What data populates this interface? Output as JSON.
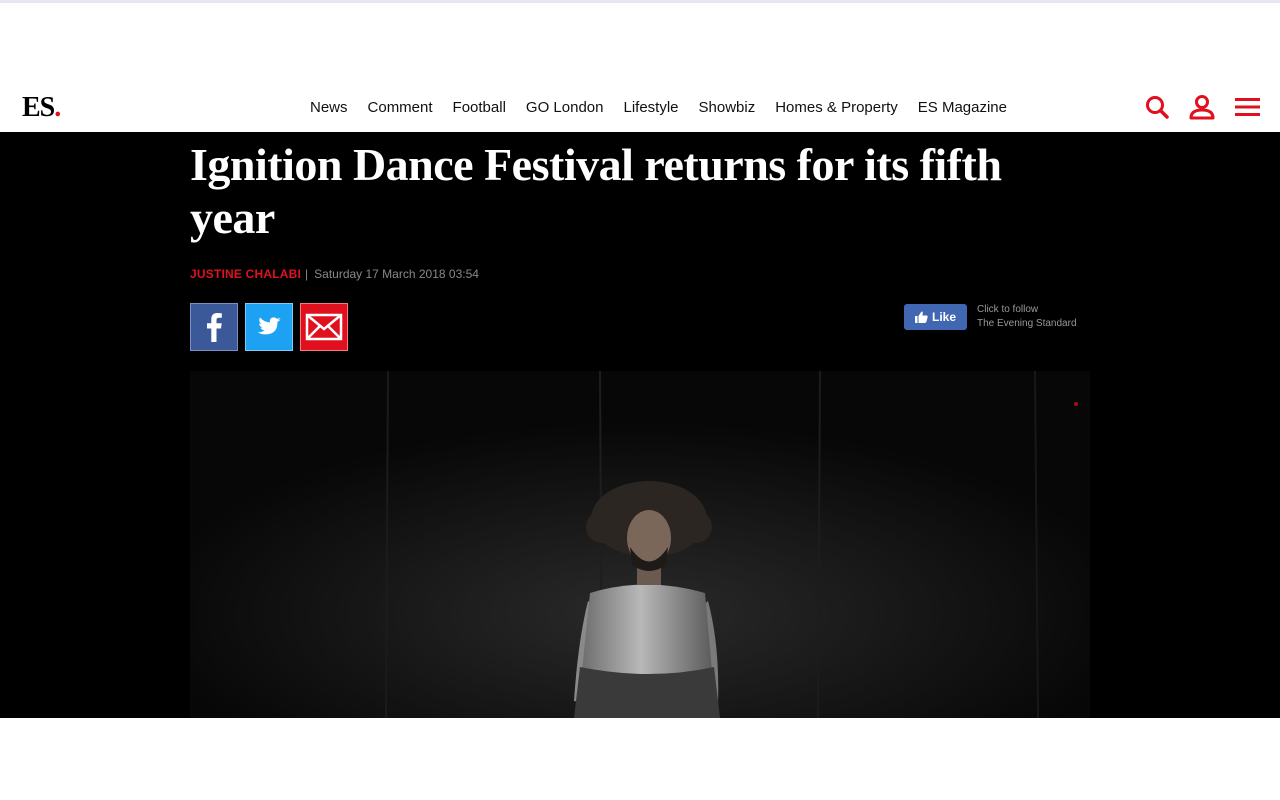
{
  "site": {
    "logo_text": "ES",
    "logo_dot": ".",
    "brand_color": "#e0101f"
  },
  "nav": {
    "items": [
      "News",
      "Comment",
      "Football",
      "GO London",
      "Lifestyle",
      "Showbiz",
      "Homes & Property",
      "ES Magazine"
    ]
  },
  "header_icons": [
    "search-icon",
    "account-icon",
    "menu-icon"
  ],
  "article": {
    "headline": "Ignition Dance Festival returns for its fifth year",
    "author": "JUSTINE CHALABI",
    "separator": "|",
    "date": "Saturday 17 March 2018 03:54"
  },
  "share": {
    "buttons": [
      "facebook-icon",
      "twitter-icon",
      "email-icon"
    ]
  },
  "facebook_like": {
    "label": "Like",
    "follow_line1": "Click to follow",
    "follow_line2": "The Evening Standard"
  },
  "colors": {
    "facebook": "#3b5998",
    "twitter": "#1da1f2",
    "email": "#e0101f",
    "fb_like": "#4267b2"
  }
}
